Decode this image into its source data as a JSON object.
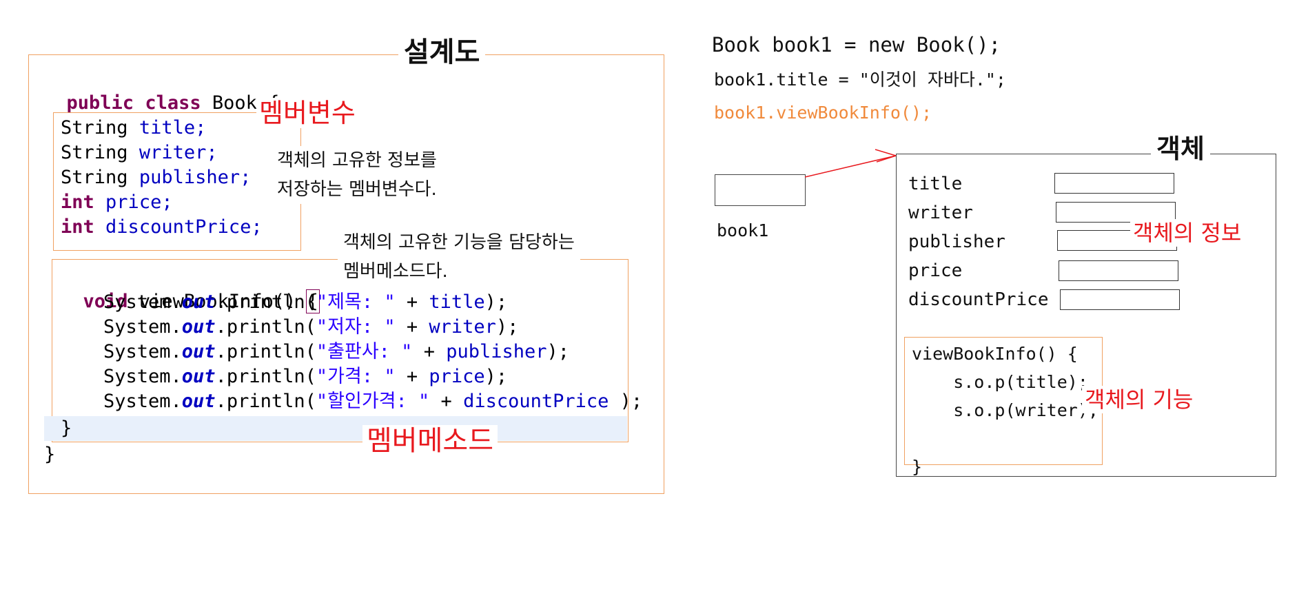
{
  "blueprint": {
    "title": "설계도",
    "class_decl": {
      "kw1": "public",
      "kw2": "class",
      "name": "Book {"
    },
    "fields": [
      {
        "type": "String",
        "name": "title;"
      },
      {
        "type": "String",
        "name": "writer;"
      },
      {
        "type": "String",
        "name": "publisher;"
      },
      {
        "type": "int",
        "name": "price;"
      },
      {
        "type": "int",
        "name": "discountPrice;"
      }
    ],
    "method_sig": {
      "kw": "void",
      "name": "viewBookInfo()",
      "brace": "{"
    },
    "prints": [
      {
        "prefix": "System.",
        "stat": "out",
        "call": ".println(",
        "str": "\"제목: \"",
        "op": " + ",
        "fld": "title",
        "end": ");"
      },
      {
        "prefix": "System.",
        "stat": "out",
        "call": ".println(",
        "str": "\"저자: \"",
        "op": " + ",
        "fld": "writer",
        "end": ");"
      },
      {
        "prefix": "System.",
        "stat": "out",
        "call": ".println(",
        "str": "\"출판사: \"",
        "op": " + ",
        "fld": "publisher",
        "end": ");"
      },
      {
        "prefix": "System.",
        "stat": "out",
        "call": ".println(",
        "str": "\"가격: \"",
        "op": " + ",
        "fld": "price",
        "end": ");"
      },
      {
        "prefix": "System.",
        "stat": "out",
        "call": ".println(",
        "str": "\"할인가격: \"",
        "op": " + ",
        "fld": "discountPrice",
        "end": " );"
      }
    ],
    "method_close": "}",
    "class_close": "}",
    "label_member_variable": "멤버변수",
    "label_member_method": "멤버메소드",
    "note_variable_line1": "객체의 고유한 정보를",
    "note_variable_line2": "저장하는 멤버변수다.",
    "note_method_line1": "객체의 고유한 기능을 담당하는",
    "note_method_line2": "멤버메소드다."
  },
  "usage": {
    "line1": "Book book1 = new Book();",
    "line2": "book1.title = \"이것이 자바다.\";",
    "line3": "book1.viewBookInfo();",
    "ref_label": "book1"
  },
  "object": {
    "title": "객체",
    "fields": [
      "title",
      "writer",
      "publisher",
      "price",
      "discountPrice"
    ],
    "label_info": "객체의 정보",
    "method_lines": [
      "viewBookInfo() {",
      "    s.o.p(title);",
      "    s.o.p(writer);",
      "",
      "}"
    ],
    "label_function": "객체의 기능"
  },
  "colors": {
    "keyword": "#7f0055",
    "field": "#0000c0",
    "string": "#2a00ff",
    "annotation_red": "#e8191e",
    "box_orange": "#f0a060",
    "call_orange": "#f08a3c"
  }
}
